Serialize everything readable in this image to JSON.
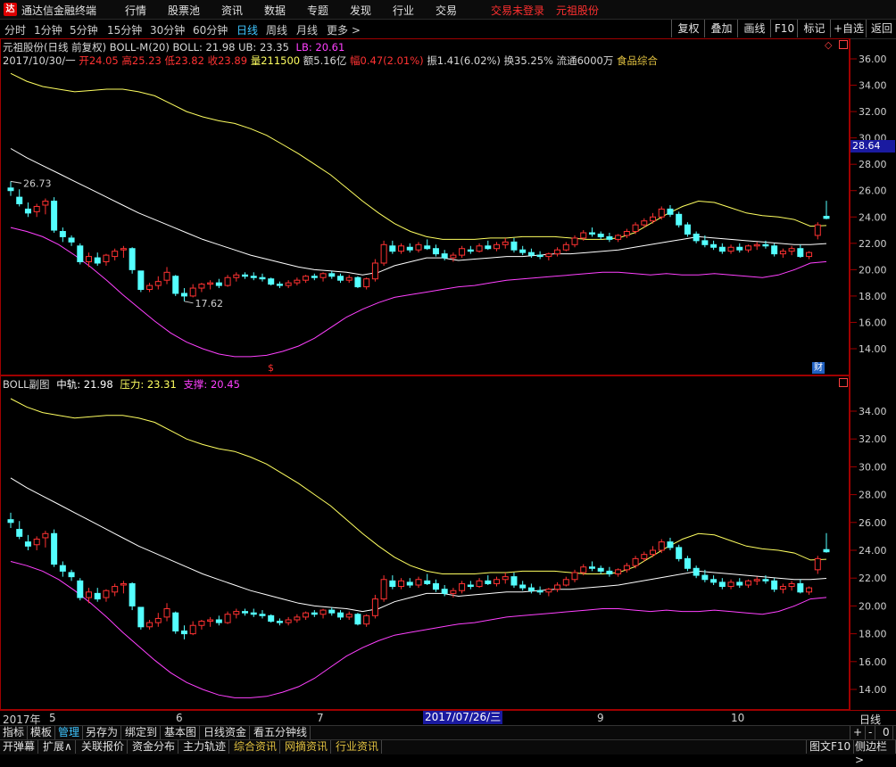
{
  "app": {
    "title": "通达信金融终端",
    "menu": [
      "行情",
      "股票池",
      "资讯",
      "数据",
      "专题",
      "发现",
      "行业",
      "交易"
    ],
    "login_status": "交易未登录",
    "stock_link": "元祖股份"
  },
  "periods": [
    "分时",
    "1分钟",
    "5分钟",
    "15分钟",
    "30分钟",
    "60分钟",
    "日线",
    "周线",
    "月线",
    "更多 >"
  ],
  "active_period": "日线",
  "toolbar_right": [
    "复权",
    "叠加",
    "画线",
    "F10",
    "标记",
    "+自选",
    "返回"
  ],
  "main_chart": {
    "title_line": "元祖股份(日线 前复权) BOLL-M(20) BOLL: 21.98  UB: 23.35",
    "lb": "LB: 20.61",
    "date": "2017/10/30/一",
    "open_label": "开24.05",
    "high_label": "高25.23",
    "low_label": "低23.82",
    "close_label": "收23.89",
    "volume_label": "量211500",
    "amount_label": "额5.16亿",
    "change_label": "幅0.47(2.01%)",
    "amplitude_label": "振1.41(6.02%)",
    "turnover_label": "换35.25%",
    "float_label": "流通6000万",
    "sector_label": "食品综合",
    "price_marker": "28.64",
    "high_annotation": "26.73",
    "low_annotation": "17.62",
    "financial_marker": "财",
    "event_marker": "$",
    "y_ticks": [
      "36.00",
      "34.00",
      "32.00",
      "30.00",
      "28.00",
      "26.00",
      "24.00",
      "22.00",
      "20.00",
      "18.00",
      "16.00",
      "14.00"
    ]
  },
  "sub_chart": {
    "name": "BOLL副图",
    "mid_label": "中轨: 21.98",
    "upper_label": "压力: 23.31",
    "lower_label": "支撑: 20.45",
    "y_ticks": [
      "34.00",
      "32.00",
      "30.00",
      "28.00",
      "26.00",
      "24.00",
      "22.00",
      "20.00",
      "18.00",
      "16.00",
      "14.00"
    ]
  },
  "date_axis": {
    "year": "2017年",
    "months": [
      "5",
      "6",
      "7",
      "9",
      "10"
    ],
    "cursor_date": "2017/07/26/三",
    "right_label": "日线"
  },
  "tabs": [
    "指标",
    "模板",
    "管理",
    "另存为",
    "绑定到",
    "基本图",
    "日线资金",
    "看五分钟线"
  ],
  "active_tab": "管理",
  "tab_controls": [
    "+",
    "-",
    "0"
  ],
  "status": [
    "开弹幕",
    "扩展∧",
    "关联报价",
    "资金分布",
    "主力轨迹",
    "综合资讯",
    "网摘资讯",
    "行业资讯"
  ],
  "status_right": [
    "图文F10",
    "侧边栏>"
  ],
  "colors": {
    "up": "#ff3232",
    "down": "#54ffff",
    "upper": "#ffff60",
    "mid": "#ffffff",
    "lower": "#ff40ff",
    "grid": "#a00000"
  },
  "chart_data": {
    "type": "candlestick",
    "title": "元祖股份(日线 前复权)",
    "indicator": "BOLL-M(20)",
    "ylim": [
      13,
      37
    ],
    "last_values": {
      "boll": 21.98,
      "ub": 23.35,
      "lb": 20.61
    },
    "last_bar": {
      "date": "2017/10/30",
      "open": 24.05,
      "high": 25.23,
      "low": 23.82,
      "close": 23.89
    },
    "upper": [
      34.9,
      34.3,
      33.9,
      33.7,
      33.5,
      33.6,
      33.7,
      33.7,
      33.5,
      33.2,
      32.6,
      32.0,
      31.6,
      31.3,
      31.1,
      30.7,
      30.2,
      29.5,
      28.8,
      28.0,
      27.2,
      26.2,
      25.2,
      24.3,
      23.5,
      22.9,
      22.5,
      22.3,
      22.3,
      22.3,
      22.4,
      22.4,
      22.5,
      22.5,
      22.5,
      22.4,
      22.3,
      22.3,
      22.4,
      22.8,
      23.5,
      24.2,
      24.8,
      25.2,
      25.1,
      24.7,
      24.3,
      24.1,
      24.0,
      23.8,
      23.3,
      23.35
    ],
    "mid": [
      29.2,
      28.5,
      27.9,
      27.3,
      26.7,
      26.1,
      25.5,
      24.9,
      24.3,
      23.8,
      23.3,
      22.8,
      22.3,
      21.9,
      21.5,
      21.1,
      20.8,
      20.5,
      20.2,
      20.0,
      19.9,
      19.8,
      19.6,
      19.8,
      20.3,
      20.6,
      20.9,
      20.9,
      20.7,
      20.8,
      20.9,
      21.0,
      21.0,
      21.1,
      21.2,
      21.2,
      21.3,
      21.4,
      21.5,
      21.7,
      21.9,
      22.1,
      22.3,
      22.5,
      22.4,
      22.3,
      22.2,
      22.1,
      22.0,
      21.9,
      21.9,
      21.98
    ],
    "lower": [
      23.2,
      22.9,
      22.5,
      21.9,
      21.1,
      20.2,
      19.2,
      18.1,
      17.1,
      16.1,
      15.2,
      14.5,
      14.0,
      13.6,
      13.4,
      13.4,
      13.5,
      13.8,
      14.2,
      14.8,
      15.6,
      16.4,
      17.0,
      17.5,
      17.9,
      18.1,
      18.3,
      18.5,
      18.7,
      18.8,
      19.0,
      19.2,
      19.3,
      19.4,
      19.5,
      19.6,
      19.7,
      19.8,
      19.8,
      19.7,
      19.6,
      19.7,
      19.6,
      19.6,
      19.7,
      19.6,
      19.5,
      19.4,
      19.6,
      20.0,
      20.5,
      20.61
    ],
    "candles": [
      [
        26.2,
        26.7,
        25.6,
        26.0
      ],
      [
        25.5,
        26.1,
        24.8,
        25.0
      ],
      [
        24.6,
        25.1,
        24.0,
        24.3
      ],
      [
        24.4,
        25.0,
        24.0,
        24.8
      ],
      [
        24.9,
        25.4,
        24.2,
        25.2
      ],
      [
        25.2,
        25.5,
        22.8,
        23.0
      ],
      [
        22.9,
        23.2,
        22.1,
        22.5
      ],
      [
        22.4,
        22.6,
        21.8,
        22.1
      ],
      [
        21.8,
        22.0,
        20.4,
        20.6
      ],
      [
        20.6,
        21.3,
        20.2,
        21.0
      ],
      [
        20.9,
        21.3,
        20.3,
        20.5
      ],
      [
        20.6,
        21.2,
        20.3,
        21.1
      ],
      [
        21.0,
        21.6,
        20.7,
        21.4
      ],
      [
        21.5,
        21.8,
        20.9,
        21.6
      ],
      [
        21.6,
        21.7,
        19.7,
        20.0
      ],
      [
        19.9,
        19.9,
        18.3,
        18.5
      ],
      [
        18.5,
        19.0,
        18.3,
        18.8
      ],
      [
        18.8,
        19.5,
        18.5,
        19.1
      ],
      [
        19.2,
        20.2,
        18.9,
        19.8
      ],
      [
        19.5,
        19.6,
        18.0,
        18.2
      ],
      [
        18.2,
        18.6,
        17.6,
        18.0
      ],
      [
        18.0,
        18.9,
        17.9,
        18.6
      ],
      [
        18.6,
        19.0,
        18.3,
        18.9
      ],
      [
        18.9,
        19.2,
        18.5,
        19.0
      ],
      [
        19.0,
        19.3,
        18.6,
        18.8
      ],
      [
        18.8,
        19.6,
        18.7,
        19.4
      ],
      [
        19.4,
        19.8,
        19.1,
        19.6
      ],
      [
        19.6,
        19.8,
        19.3,
        19.5
      ],
      [
        19.5,
        19.8,
        19.2,
        19.4
      ],
      [
        19.4,
        19.7,
        19.1,
        19.3
      ],
      [
        19.3,
        19.4,
        18.8,
        18.9
      ],
      [
        18.9,
        19.1,
        18.6,
        18.8
      ],
      [
        18.8,
        19.2,
        18.6,
        19.0
      ],
      [
        19.0,
        19.4,
        18.8,
        19.2
      ],
      [
        19.2,
        19.6,
        19.0,
        19.5
      ],
      [
        19.5,
        19.7,
        19.2,
        19.4
      ],
      [
        19.4,
        19.8,
        19.1,
        19.7
      ],
      [
        19.7,
        19.9,
        19.3,
        19.5
      ],
      [
        19.5,
        19.7,
        19.0,
        19.2
      ],
      [
        19.2,
        19.6,
        19.0,
        19.4
      ],
      [
        19.4,
        19.5,
        18.6,
        18.7
      ],
      [
        18.7,
        19.4,
        18.5,
        19.3
      ],
      [
        19.3,
        20.8,
        19.1,
        20.5
      ],
      [
        20.5,
        22.2,
        20.3,
        21.9
      ],
      [
        21.8,
        22.2,
        21.2,
        21.4
      ],
      [
        21.4,
        22.0,
        21.2,
        21.8
      ],
      [
        21.7,
        22.0,
        21.3,
        21.5
      ],
      [
        21.5,
        22.1,
        21.3,
        21.9
      ],
      [
        21.8,
        22.3,
        21.5,
        21.6
      ],
      [
        21.6,
        21.9,
        21.0,
        21.2
      ],
      [
        21.2,
        21.5,
        20.7,
        20.9
      ],
      [
        20.9,
        21.3,
        20.6,
        21.1
      ],
      [
        21.1,
        21.8,
        20.9,
        21.6
      ],
      [
        21.5,
        21.8,
        21.2,
        21.4
      ],
      [
        21.4,
        22.0,
        21.3,
        21.8
      ],
      [
        21.8,
        22.2,
        21.5,
        21.6
      ],
      [
        21.6,
        22.1,
        21.4,
        21.9
      ],
      [
        21.9,
        22.4,
        21.6,
        22.1
      ],
      [
        22.1,
        22.4,
        21.3,
        21.5
      ],
      [
        21.5,
        21.8,
        21.1,
        21.3
      ],
      [
        21.3,
        21.6,
        20.9,
        21.1
      ],
      [
        21.1,
        21.4,
        20.8,
        21.0
      ],
      [
        21.0,
        21.3,
        20.7,
        21.2
      ],
      [
        21.2,
        21.7,
        21.0,
        21.5
      ],
      [
        21.5,
        22.1,
        21.4,
        21.9
      ],
      [
        21.9,
        22.6,
        21.7,
        22.4
      ],
      [
        22.4,
        23.0,
        22.2,
        22.8
      ],
      [
        22.8,
        23.2,
        22.5,
        22.7
      ],
      [
        22.7,
        22.9,
        22.3,
        22.5
      ],
      [
        22.5,
        22.8,
        22.1,
        22.3
      ],
      [
        22.3,
        22.7,
        22.1,
        22.6
      ],
      [
        22.6,
        23.1,
        22.4,
        22.9
      ],
      [
        22.9,
        23.6,
        22.7,
        23.4
      ],
      [
        23.4,
        23.9,
        23.2,
        23.7
      ],
      [
        23.7,
        24.3,
        23.5,
        24.0
      ],
      [
        24.0,
        24.8,
        23.8,
        24.6
      ],
      [
        24.6,
        24.9,
        24.0,
        24.2
      ],
      [
        24.2,
        24.4,
        23.2,
        23.4
      ],
      [
        23.4,
        23.6,
        22.5,
        22.7
      ],
      [
        22.7,
        22.9,
        22.0,
        22.2
      ],
      [
        22.2,
        22.6,
        21.7,
        21.9
      ],
      [
        21.9,
        22.2,
        21.5,
        21.7
      ],
      [
        21.7,
        22.0,
        21.2,
        21.4
      ],
      [
        21.4,
        21.9,
        21.2,
        21.7
      ],
      [
        21.7,
        22.0,
        21.3,
        21.5
      ],
      [
        21.5,
        21.9,
        21.3,
        21.8
      ],
      [
        21.8,
        22.1,
        21.5,
        21.9
      ],
      [
        21.9,
        22.2,
        21.6,
        21.8
      ],
      [
        21.8,
        22.0,
        21.0,
        21.2
      ],
      [
        21.2,
        21.6,
        20.9,
        21.4
      ],
      [
        21.4,
        21.8,
        21.1,
        21.6
      ],
      [
        21.6,
        21.9,
        20.9,
        21.0
      ],
      [
        21.0,
        21.4,
        20.8,
        21.3
      ],
      [
        22.6,
        23.6,
        22.3,
        23.4
      ],
      [
        24.05,
        25.23,
        23.82,
        23.89
      ]
    ]
  }
}
